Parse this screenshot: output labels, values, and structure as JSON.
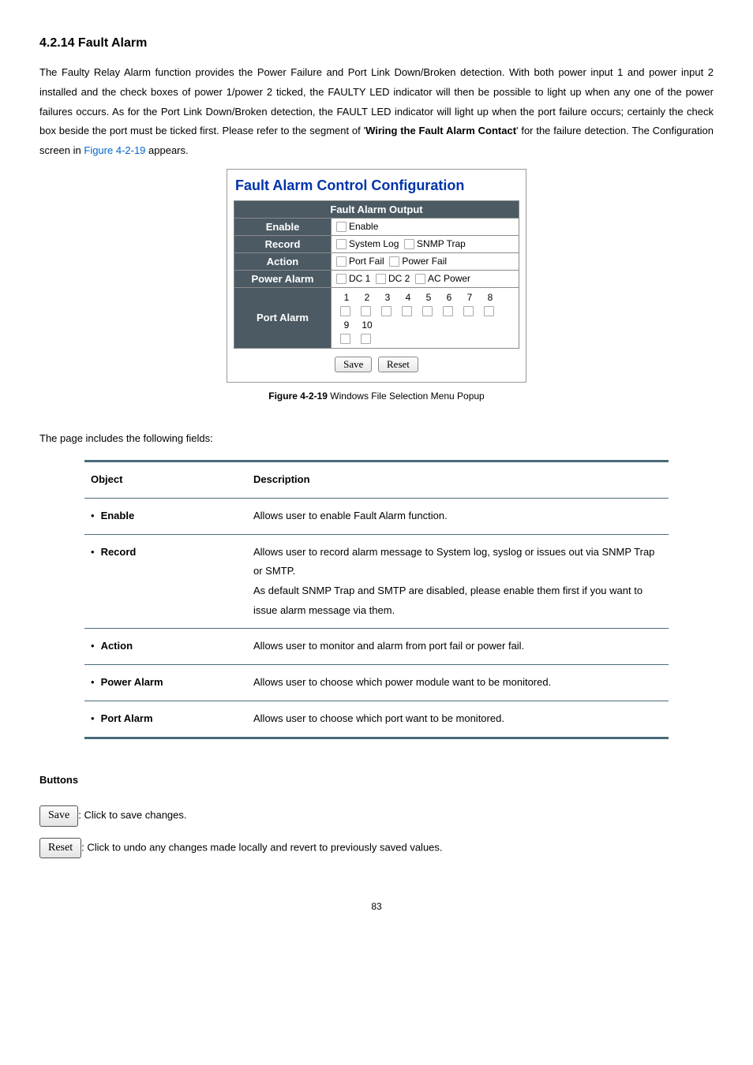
{
  "heading": "4.2.14 Fault Alarm",
  "intro": {
    "p1": "The Faulty Relay Alarm function provides the Power Failure and Port Link Down/Broken detection. With both power input 1 and power input 2 installed and the check boxes of power 1/power 2 ticked, the FAULTY LED indicator will then be possible to light up when any one of the power failures occurs. As for the Port Link Down/Broken detection, the FAULT LED indicator will light up when the port failure occurs; certainly the check box beside the port must be ticked first. Please refer to the segment of '",
    "bold1": "Wiring the Fault Alarm Contact",
    "p2": "' for the failure detection. The Configuration screen in ",
    "figlink": "Figure 4-2-19",
    "p3": " appears."
  },
  "config": {
    "title": "Fault Alarm Control Configuration",
    "headerrow": "Fault Alarm Output",
    "rows": {
      "enable": {
        "label": "Enable",
        "opt1": "Enable"
      },
      "record": {
        "label": "Record",
        "opt1": "System Log",
        "opt2": "SNMP Trap"
      },
      "action": {
        "label": "Action",
        "opt1": "Port Fail",
        "opt2": "Power Fail"
      },
      "power": {
        "label": "Power Alarm",
        "opt1": "DC 1",
        "opt2": "DC 2",
        "opt3": "AC Power"
      },
      "port": {
        "label": "Port Alarm",
        "n1": "1",
        "n2": "2",
        "n3": "3",
        "n4": "4",
        "n5": "5",
        "n6": "6",
        "n7": "7",
        "n8": "8",
        "n9": "9",
        "n10": "10"
      }
    },
    "save": "Save",
    "reset": "Reset"
  },
  "figcaption": {
    "pre": "Figure 4-2-19 ",
    "text": "Windows File Selection Menu Popup"
  },
  "fields_intro": "The page includes the following fields:",
  "table": {
    "h1": "Object",
    "h2": "Description",
    "r1": {
      "obj": "Enable",
      "desc": "Allows user to enable Fault Alarm function."
    },
    "r2": {
      "obj": "Record",
      "desc": "Allows user to record alarm message to System log, syslog or issues out via SNMP Trap or SMTP.\nAs default SNMP Trap and SMTP are disabled, please enable them first if you want to issue alarm message via them."
    },
    "r3": {
      "obj": "Action",
      "desc": "Allows user to monitor and alarm from port fail or power fail."
    },
    "r4": {
      "obj": "Power Alarm",
      "desc": "Allows user to choose which power module want to be monitored."
    },
    "r5": {
      "obj": "Port Alarm",
      "desc": "Allows user to choose which port want to be monitored."
    }
  },
  "buttons_heading": "Buttons",
  "btn_save": {
    "label": "Save",
    "desc": ": Click to save changes."
  },
  "btn_reset": {
    "label": "Reset",
    "desc": ": Click to undo any changes made locally and revert to previously saved values."
  },
  "page_num": "83"
}
